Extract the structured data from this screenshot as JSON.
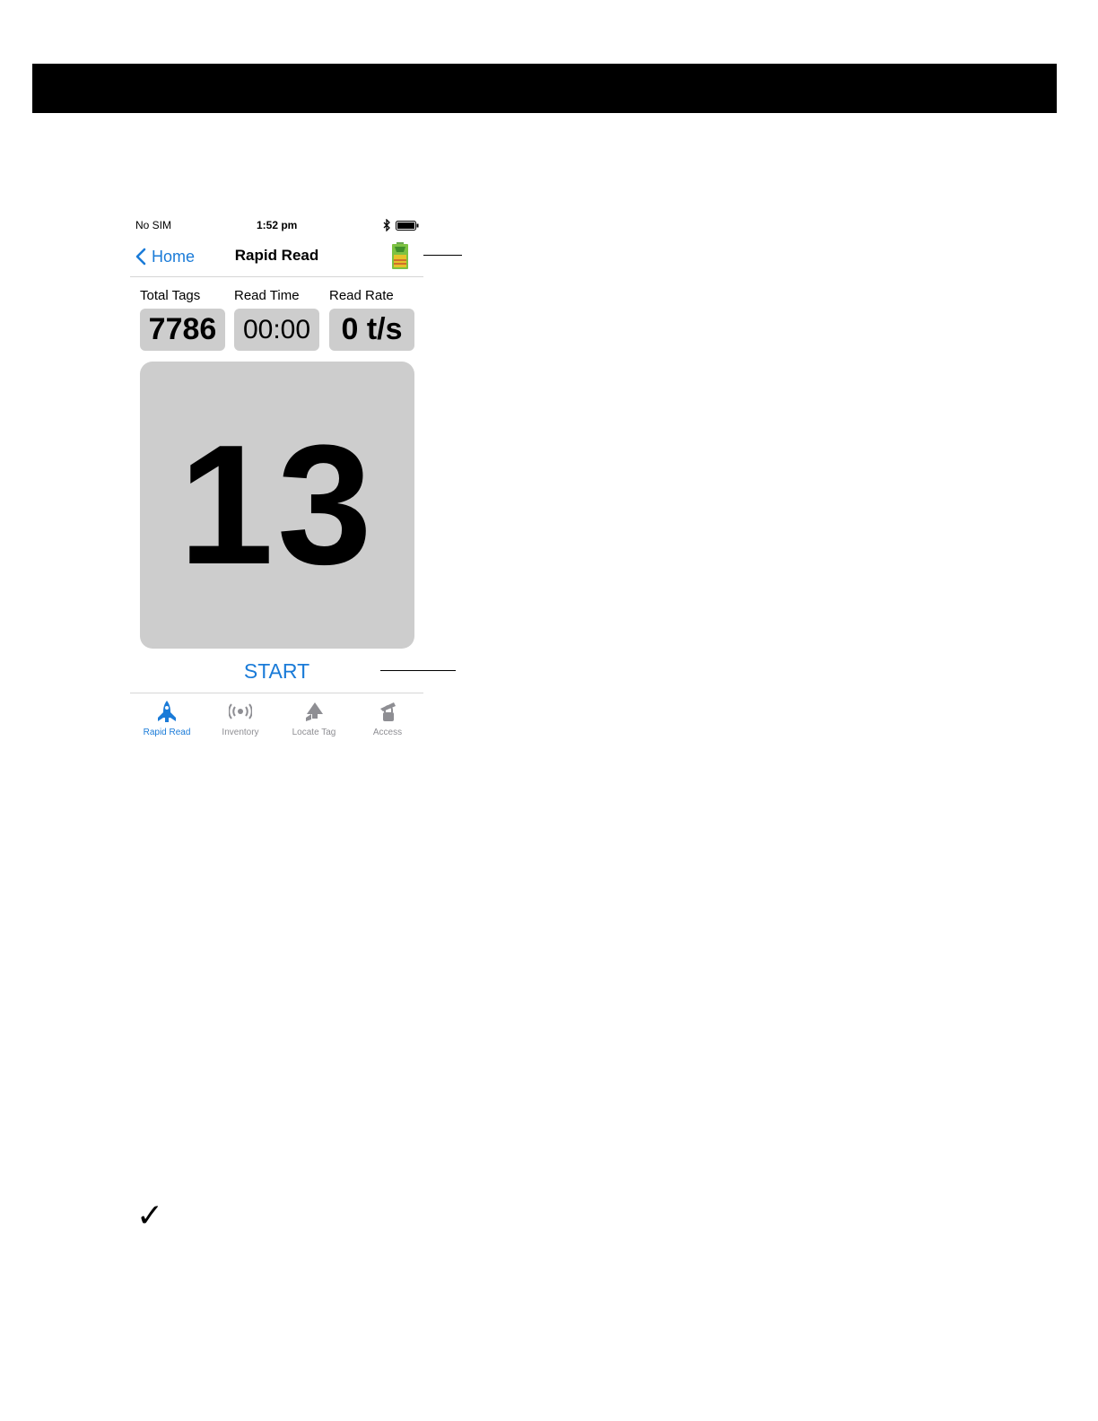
{
  "status_bar": {
    "carrier": "No SIM",
    "time": "1:52 pm"
  },
  "nav": {
    "back_label": "Home",
    "title": "Rapid Read"
  },
  "stats": [
    {
      "label": "Total Tags",
      "value": "7786"
    },
    {
      "label": "Read Time",
      "value": "00:00"
    },
    {
      "label": "Read Rate",
      "value": "0 t/s"
    }
  ],
  "main_count": "13",
  "start_label": "START",
  "tabs": [
    {
      "label": "Rapid Read",
      "icon": "rocket-icon",
      "active": true
    },
    {
      "label": "Inventory",
      "icon": "inventory-icon",
      "active": false
    },
    {
      "label": "Locate Tag",
      "icon": "locate-tag-icon",
      "active": false
    },
    {
      "label": "Access",
      "icon": "access-icon",
      "active": false
    }
  ],
  "colors": {
    "accent": "#1a7bd8",
    "tile": "#cdcdcd",
    "inactive": "#8e8e93"
  },
  "note_icon": "checkmark-icon"
}
